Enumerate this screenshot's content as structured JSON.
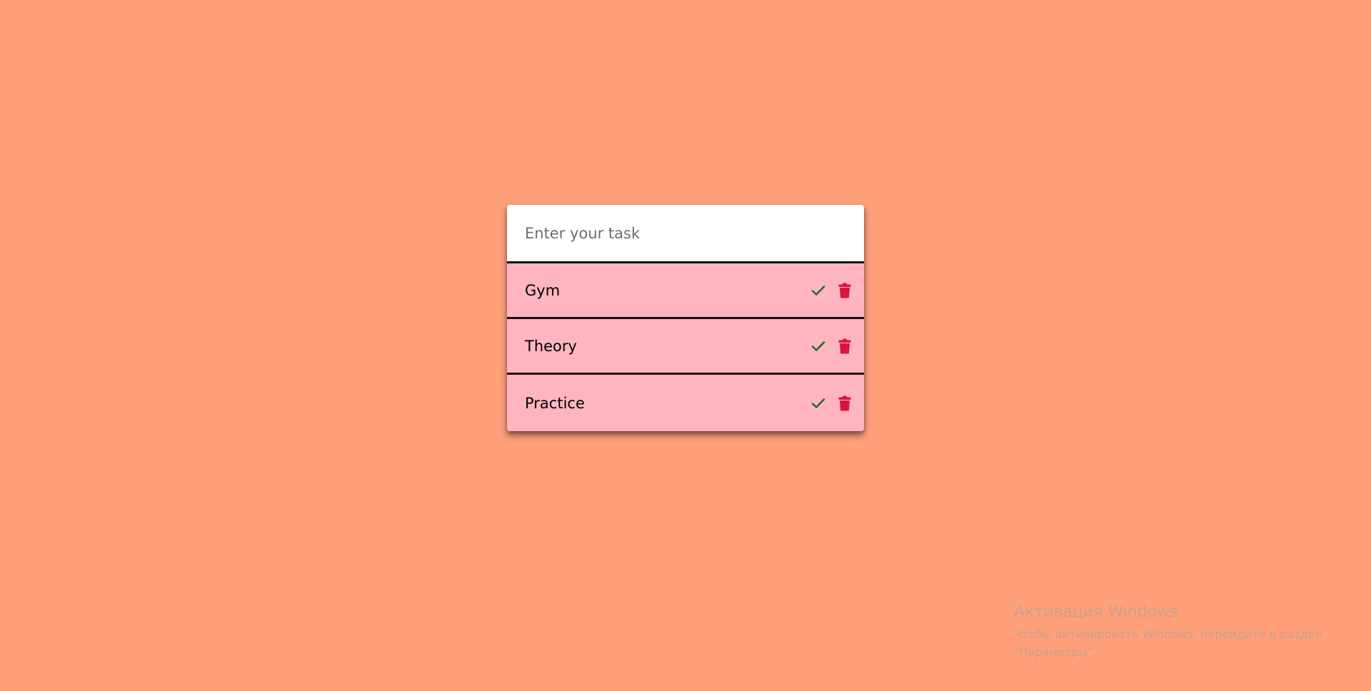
{
  "input": {
    "placeholder": "Enter your task",
    "value": ""
  },
  "tasks": [
    {
      "label": "Gym"
    },
    {
      "label": "Theory"
    },
    {
      "label": "Practice"
    }
  ],
  "icons": {
    "complete": "check-icon",
    "delete": "trash-icon"
  },
  "colors": {
    "background": "#ffa07a",
    "task_bg": "#ffb5c0",
    "check": "#1d6e2a",
    "trash": "#dc143c"
  },
  "watermark": {
    "title": "Активация Windows",
    "text": "Чтобы активировать Windows, перейдите в раздел \"Параметры\"."
  }
}
